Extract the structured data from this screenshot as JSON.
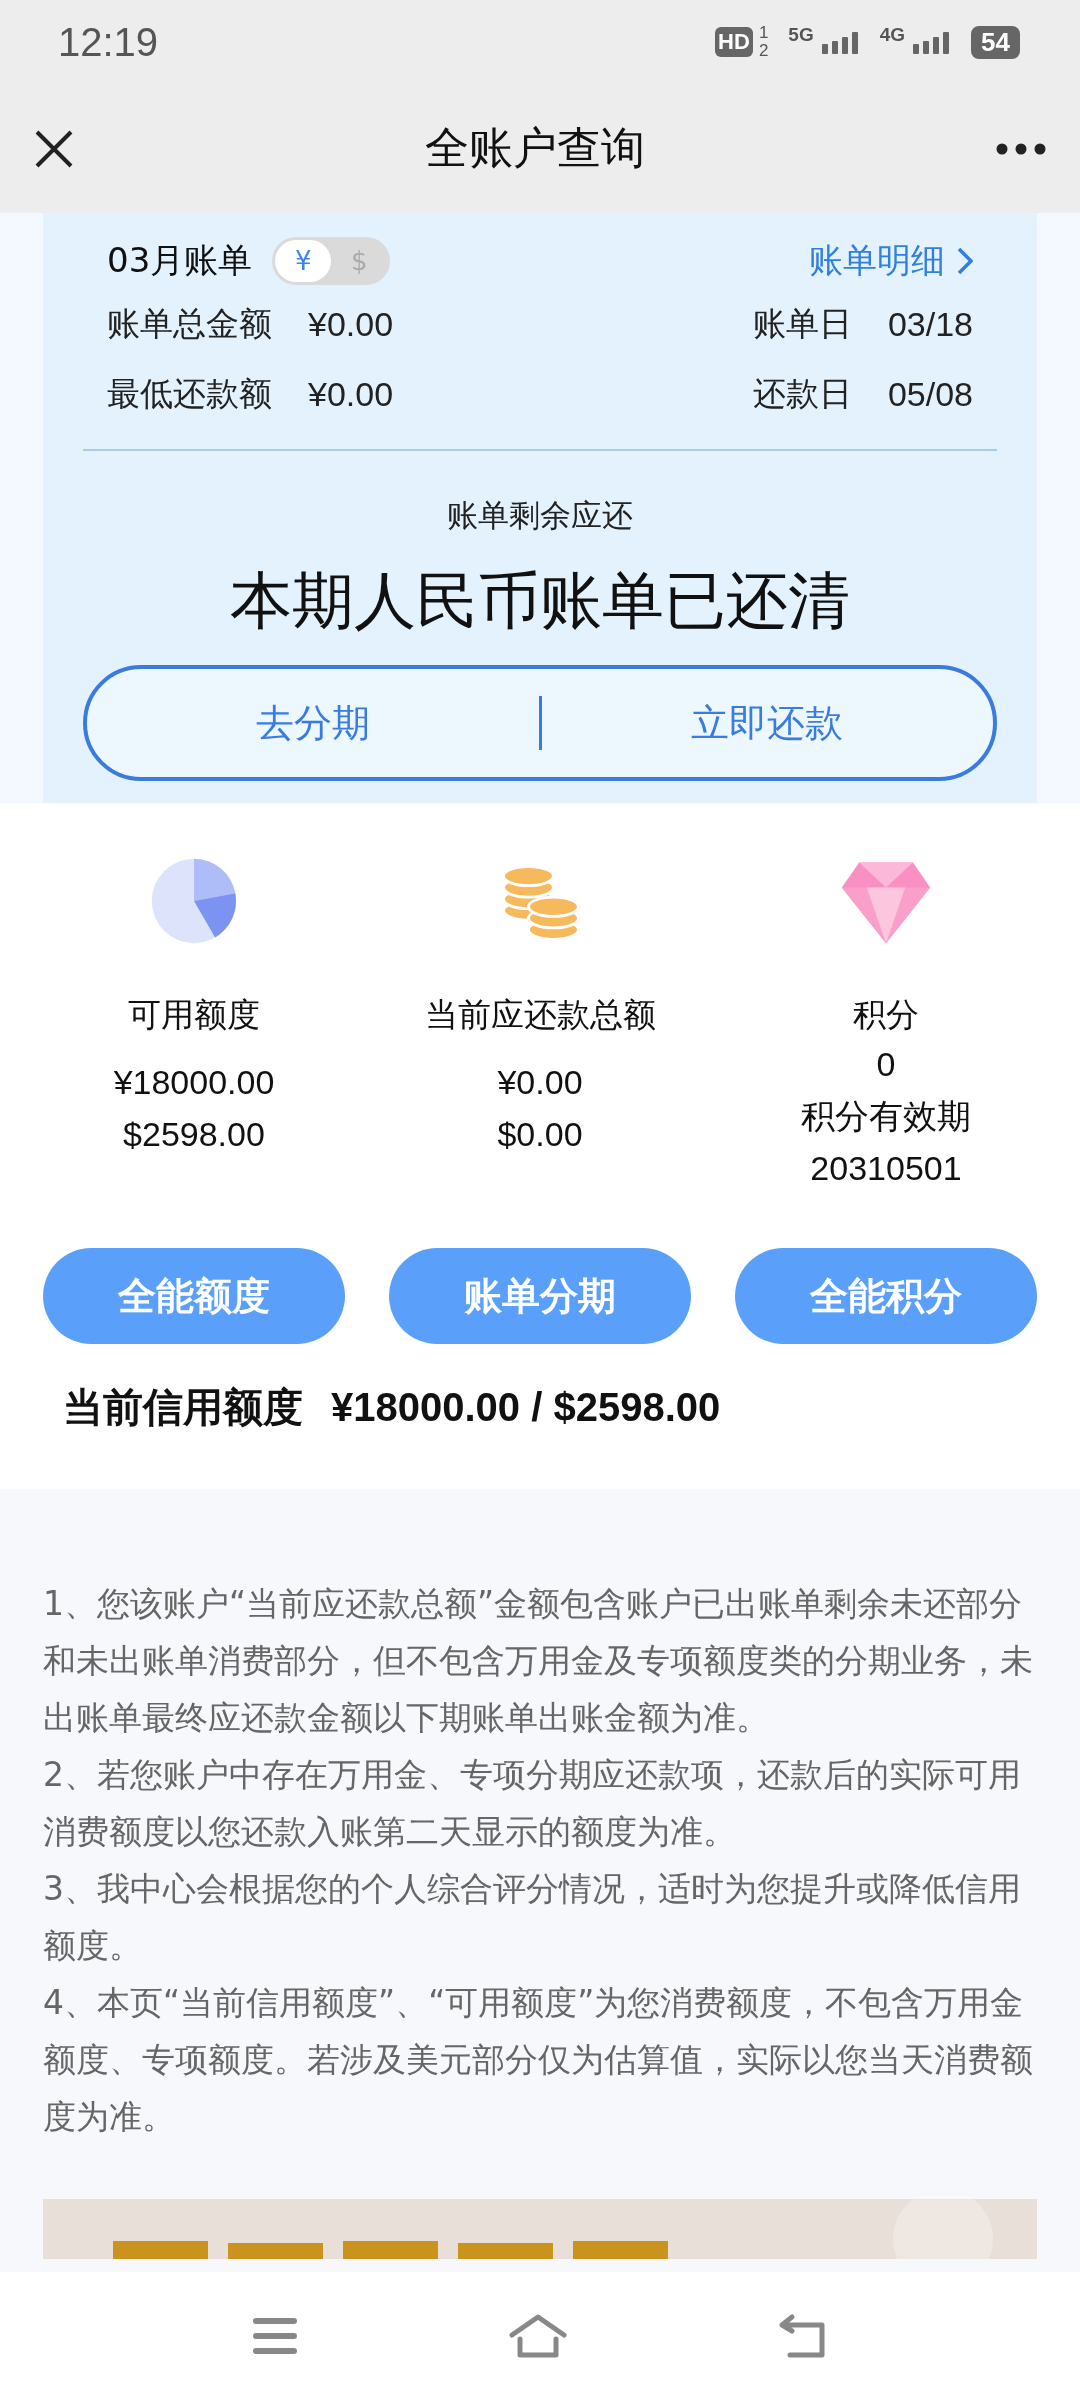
{
  "status_bar": {
    "time": "12:19",
    "hd": "HD",
    "hd_sims": [
      "1",
      "2"
    ],
    "networks": [
      "5G",
      "4G"
    ],
    "battery": "54"
  },
  "nav": {
    "title": "全账户查询"
  },
  "bill": {
    "month": "03月账单",
    "currency_toggle": [
      {
        "label": "¥",
        "selected": true
      },
      {
        "label": "$",
        "selected": false
      }
    ],
    "detail_link": "账单明细",
    "rows": [
      {
        "label": "账单总金额",
        "value": "¥0.00",
        "date_label": "账单日",
        "date": "03/18"
      },
      {
        "label": "最低还款额",
        "value": "¥0.00",
        "date_label": "还款日",
        "date": "05/08"
      }
    ],
    "remaining_label": "账单剩余应还",
    "remaining_status": "本期人民币账单已还清",
    "actions": [
      "去分期",
      "立即还款"
    ]
  },
  "summary": [
    {
      "label": "可用额度",
      "lines": [
        "¥18000.00",
        "$2598.00"
      ],
      "button": "全能额度"
    },
    {
      "label": "当前应还款总额",
      "lines": [
        "¥0.00",
        "$0.00"
      ],
      "button": "账单分期"
    },
    {
      "label": "积分",
      "lines": [
        "0",
        "积分有效期",
        "20310501"
      ],
      "button": "全能积分"
    }
  ],
  "credit": {
    "label": "当前信用额度",
    "value": "¥18000.00 / $2598.00"
  },
  "notes": [
    "1、您该账户“当前应还款总额”金额包含账户已出账单剩余未还部分和未出账单消费部分，但不包含万用金及专项额度类的分期业务，未出账单最终应还款金额以下期账单出账金额为准。",
    "2、若您账户中存在万用金、专项分期应还款项，还款后的实际可用消费额度以您还款入账第二天显示的额度为准。",
    "3、我中心会根据您的个人综合评分情况，适时为您提升或降低信用额度。",
    "4、本页“当前信用额度”、“可用额度”为您消费额度，不包含万用金额度、专项额度。若涉及美元部分仅为估算值，实际以您当天消费额度为准。"
  ]
}
